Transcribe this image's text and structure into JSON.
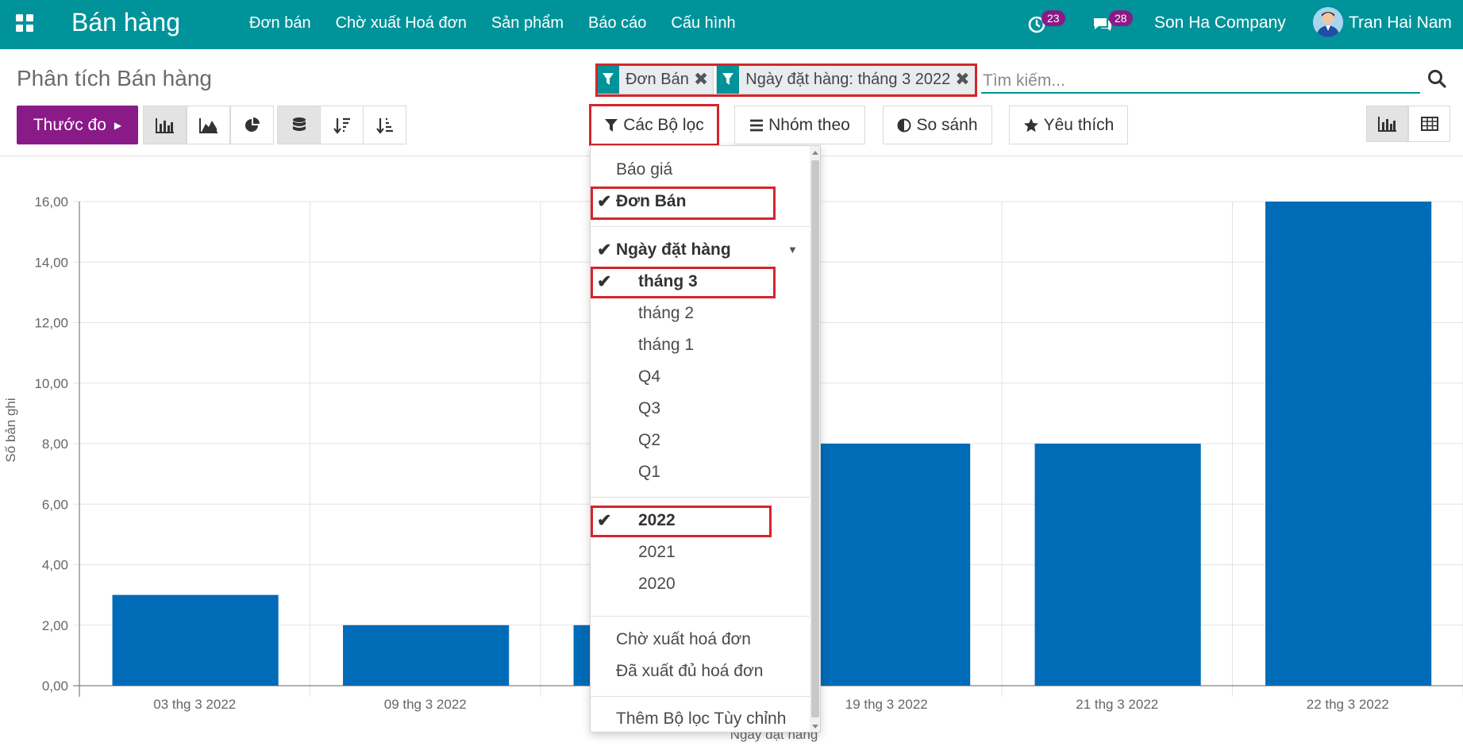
{
  "navbar": {
    "brand": "Bán hàng",
    "menu": [
      "Đơn bán",
      "Chờ xuất Hoá đơn",
      "Sản phẩm",
      "Báo cáo",
      "Cấu hình"
    ],
    "activity_count": "23",
    "message_count": "28",
    "company": "Son Ha Company",
    "user": "Tran Hai Nam"
  },
  "control_panel": {
    "title": "Phân tích Bán hàng",
    "facets": [
      {
        "value": "Đơn Bán",
        "remove": "✖"
      },
      {
        "value": "Ngày đặt hàng: tháng 3 2022",
        "remove": "✖"
      }
    ],
    "search_placeholder": "Tìm kiếm...",
    "measure_label": "Thước đo",
    "filters_label": "Các Bộ lọc",
    "groupby_label": "Nhóm theo",
    "compare_label": "So sánh",
    "favorites_label": "Yêu thích"
  },
  "dropdown": {
    "items": [
      {
        "label": "Báo giá",
        "checked": false
      },
      {
        "label": "Đơn Bán",
        "checked": true
      },
      {
        "label": "Ngày đặt hàng",
        "checked": true
      },
      {
        "label": "tháng 3",
        "checked": true
      },
      {
        "label": "tháng 2",
        "checked": false
      },
      {
        "label": "tháng 1",
        "checked": false
      },
      {
        "label": "Q4",
        "checked": false
      },
      {
        "label": "Q3",
        "checked": false
      },
      {
        "label": "Q2",
        "checked": false
      },
      {
        "label": "Q1",
        "checked": false
      },
      {
        "label": "2022",
        "checked": true
      },
      {
        "label": "2021",
        "checked": false
      },
      {
        "label": "2020",
        "checked": false
      },
      {
        "label": "Chờ xuất hoá đơn",
        "checked": false
      },
      {
        "label": "Đã xuất đủ hoá đơn",
        "checked": false
      },
      {
        "label": "Thêm Bộ lọc Tùy chỉnh",
        "checked": false
      }
    ],
    "check_glyph": "✔",
    "caret_glyph": "▼"
  },
  "chart_data": {
    "type": "bar",
    "categories": [
      "03 thg 3 2022",
      "09 thg 3 2022",
      "",
      "19 thg 3 2022",
      "21 thg 3 2022",
      "22 thg 3 2022"
    ],
    "values": [
      3,
      2,
      2,
      8,
      8,
      16
    ],
    "ylabel": "Số bản ghi",
    "xlabel": "Ngày đặt hàng",
    "ylim": [
      0,
      16
    ],
    "yticks": [
      "0,00",
      "2,00",
      "4,00",
      "6,00",
      "8,00",
      "10,00",
      "12,00",
      "14,00",
      "16,00"
    ],
    "bar_color": "#006bb6",
    "grid": true,
    "legend": "none"
  }
}
